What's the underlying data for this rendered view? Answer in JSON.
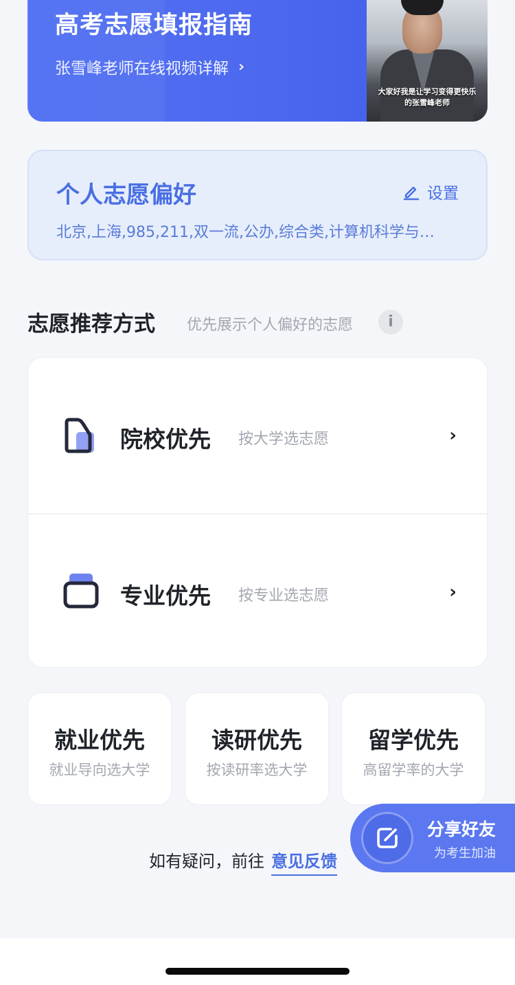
{
  "banner": {
    "title": "高考志愿填报指南",
    "subtitle": "张雪峰老师在线视频详解",
    "chevron": "›",
    "video_caption_line1": "大家好我是让学习变得更快乐",
    "video_caption_line2": "的张雪峰老师"
  },
  "preference": {
    "title": "个人志愿偏好",
    "edit_label": "设置",
    "summary": "北京,上海,985,211,双一流,公办,综合类,计算机科学与…"
  },
  "section": {
    "title": "志愿推荐方式",
    "hint": "优先展示个人偏好的志愿",
    "info": "i"
  },
  "options": [
    {
      "label": "院校优先",
      "sub": "按大学选志愿",
      "chevron": "›"
    },
    {
      "label": "专业优先",
      "sub": "按专业选志愿",
      "chevron": "›"
    }
  ],
  "small_cards": [
    {
      "title": "就业优先",
      "sub": "就业导向选大学"
    },
    {
      "title": "读研优先",
      "sub": "按读研率选大学"
    },
    {
      "title": "留学优先",
      "sub": "高留学率的大学"
    }
  ],
  "feedback": {
    "prefix": "如有疑问，前往",
    "link": "意见反馈"
  },
  "share": {
    "title": "分享好友",
    "sub": "为考生加油"
  },
  "colors": {
    "accent": "#4a6fe3",
    "banner": "#4a66ee",
    "pref_bg": "#e6eefb"
  }
}
